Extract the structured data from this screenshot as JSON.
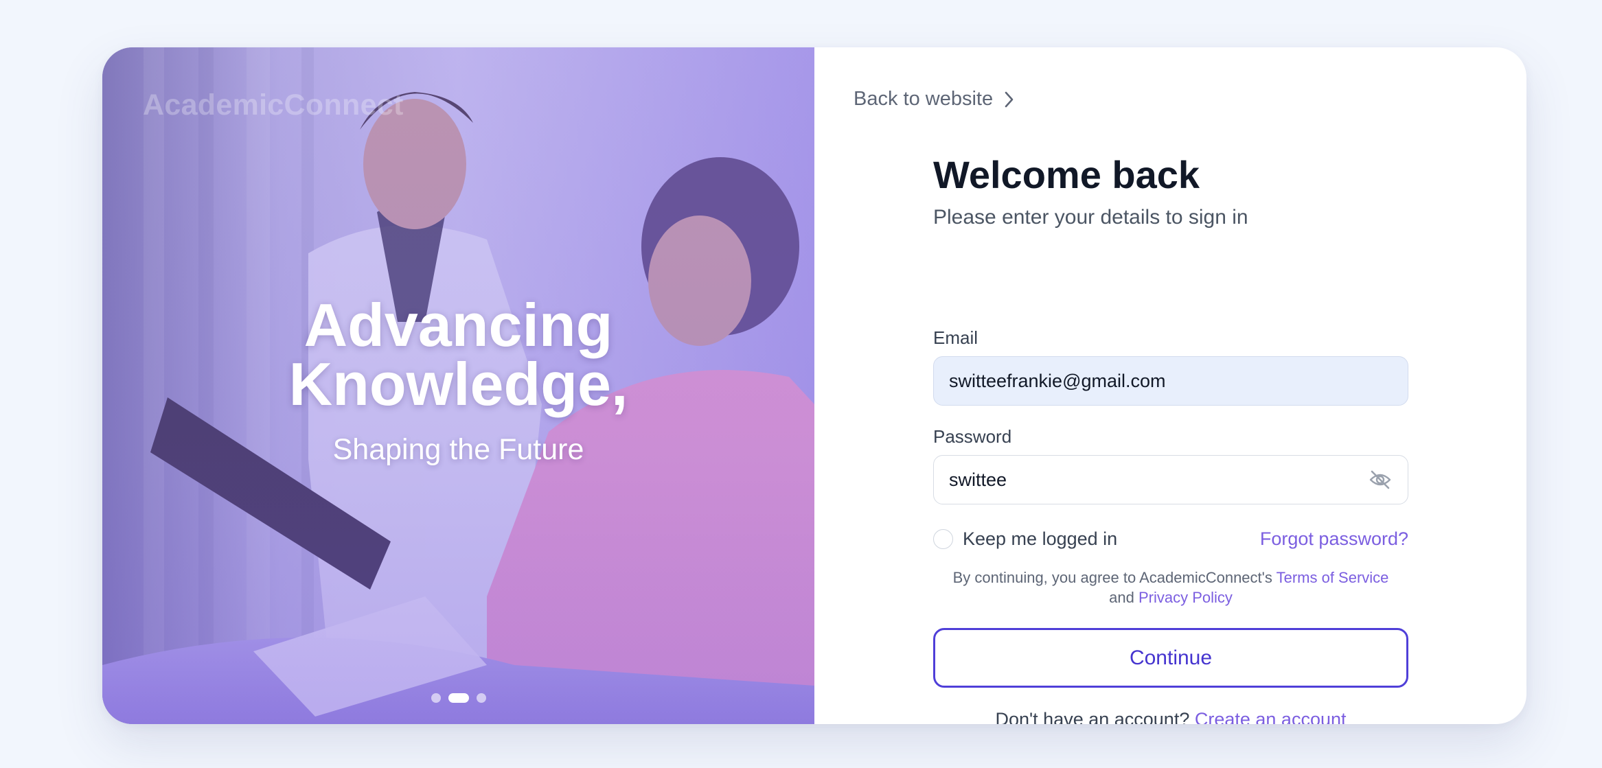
{
  "hero": {
    "brand": "AcademicConnect",
    "headline_line1": "Advancing",
    "headline_line2": "Knowledge,",
    "subline": "Shaping the Future",
    "carousel_active_index": 1,
    "carousel_count": 3
  },
  "nav": {
    "back_label": "Back to website"
  },
  "form": {
    "title": "Welcome back",
    "subtitle": "Please enter your details to sign in",
    "email_label": "Email",
    "email_value": "switteefrankie@gmail.com",
    "password_label": "Password",
    "password_value": "swittee",
    "remember_label": "Keep me logged in",
    "remember_checked": false,
    "forgot_label": "Forgot password?",
    "terms_prefix": "By continuing, you agree to AcademicConnect's",
    "terms_link": "Terms of Service",
    "terms_and": "and",
    "privacy_link": "Privacy Policy",
    "continue_label": "Continue",
    "signup_prompt": "Don't have an account?",
    "signup_link": "Create an account"
  },
  "colors": {
    "accent": "#4f3fd8",
    "link": "#7b5ee0",
    "page_bg": "#f2f6fd",
    "email_field_bg": "#e8effc"
  }
}
